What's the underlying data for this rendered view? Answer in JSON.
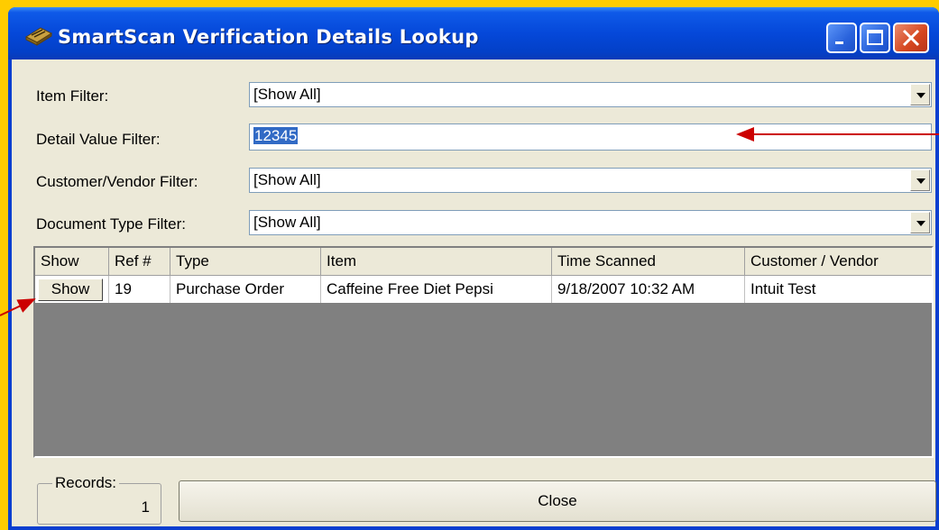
{
  "window": {
    "title": "SmartScan Verification Details Lookup"
  },
  "filters": {
    "item_label": "Item Filter:",
    "item_value": "[Show All]",
    "detail_label": "Detail Value Filter:",
    "detail_value": "12345",
    "customer_label": "Customer/Vendor Filter:",
    "customer_value": "[Show All]",
    "doctype_label": "Document Type Filter:",
    "doctype_value": "[Show All]"
  },
  "grid": {
    "columns": [
      "Show",
      "Ref #",
      "Type",
      "Item",
      "Time Scanned",
      "Customer / Vendor"
    ],
    "rows": [
      {
        "show": "Show",
        "ref": "19",
        "type": "Purchase Order",
        "item": "Caffeine Free Diet Pepsi",
        "time": "9/18/2007 10:32 AM",
        "customer": "Intuit Test"
      }
    ]
  },
  "records": {
    "label": "Records:",
    "count": "1"
  },
  "buttons": {
    "close": "Close"
  },
  "colors": {
    "annotation_arrow": "#CC0000",
    "title_bar": "#0548D9"
  }
}
